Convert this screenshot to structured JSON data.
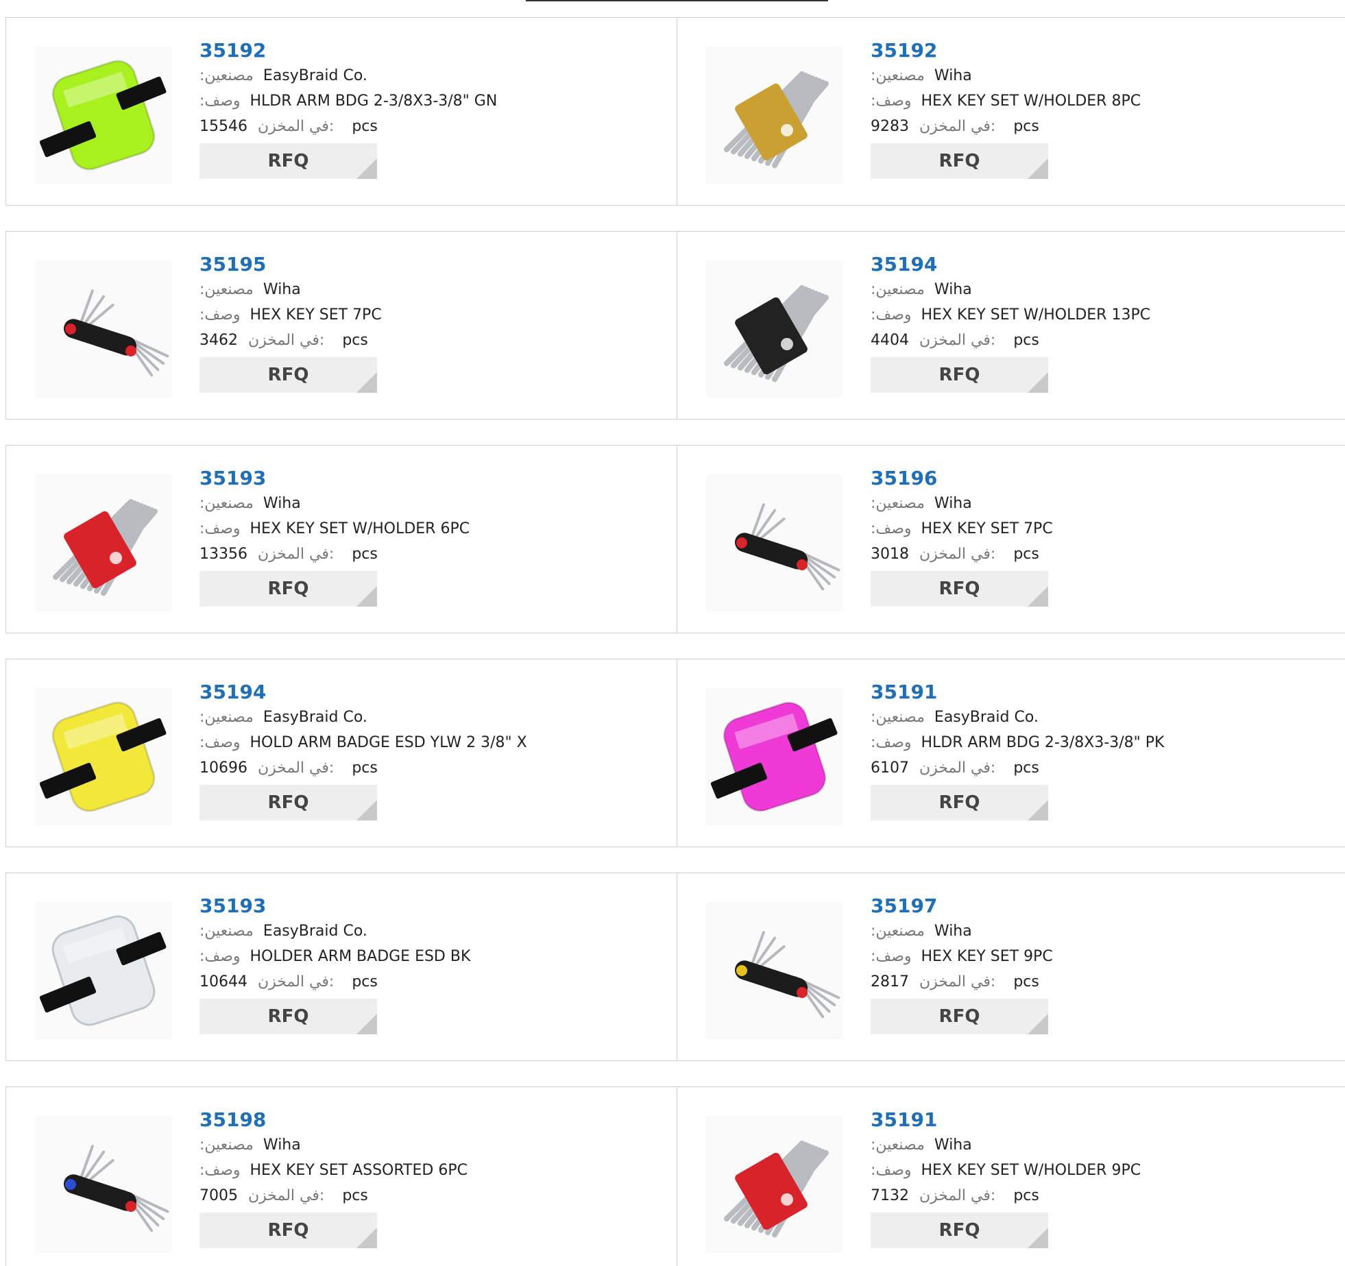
{
  "labels": {
    "manufacturer": ":مصنعين",
    "description": ":وصف",
    "stock": "في المخزن:",
    "unit": "pcs",
    "rfq": "RFQ"
  },
  "products": [
    {
      "part": "35192",
      "mfr": "EasyBraid Co.",
      "desc": "HLDR ARM BDG 2-3/8X3-3/8\" GN",
      "stock": "15546",
      "thumb": "armband-green"
    },
    {
      "part": "35192",
      "mfr": "Wiha",
      "desc": "HEX KEY SET W/HOLDER 8PC",
      "stock": "9283",
      "thumb": "hex-key-holder-yellow"
    },
    {
      "part": "35195",
      "mfr": "Wiha",
      "desc": "HEX KEY SET 7PC",
      "stock": "3462",
      "thumb": "folding-hex-key"
    },
    {
      "part": "35194",
      "mfr": "Wiha",
      "desc": "HEX KEY SET W/HOLDER 13PC",
      "stock": "4404",
      "thumb": "hex-key-holder-black"
    },
    {
      "part": "35193",
      "mfr": "Wiha",
      "desc": "HEX KEY SET W/HOLDER 6PC",
      "stock": "13356",
      "thumb": "hex-key-holder-red"
    },
    {
      "part": "35196",
      "mfr": "Wiha",
      "desc": "HEX KEY SET 7PC",
      "stock": "3018",
      "thumb": "folding-hex-key"
    },
    {
      "part": "35194",
      "mfr": "EasyBraid Co.",
      "desc": "HOLD ARM BADGE ESD YLW 2 3/8\" X",
      "stock": "10696",
      "thumb": "armband-yellow"
    },
    {
      "part": "35191",
      "mfr": "EasyBraid Co.",
      "desc": "HLDR ARM BDG 2-3/8X3-3/8\" PK",
      "stock": "6107",
      "thumb": "armband-pink"
    },
    {
      "part": "35193",
      "mfr": "EasyBraid Co.",
      "desc": "HOLDER ARM BADGE ESD BK",
      "stock": "10644",
      "thumb": "armband-clear"
    },
    {
      "part": "35197",
      "mfr": "Wiha",
      "desc": "HEX KEY SET 9PC",
      "stock": "2817",
      "thumb": "folding-hex-key-yellow"
    },
    {
      "part": "35198",
      "mfr": "Wiha",
      "desc": "HEX KEY SET ASSORTED 6PC",
      "stock": "7005",
      "thumb": "folding-hex-key-blue"
    },
    {
      "part": "35191",
      "mfr": "Wiha",
      "desc": "HEX KEY SET W/HOLDER 9PC",
      "stock": "7132",
      "thumb": "hex-key-holder-red"
    }
  ],
  "colors": {
    "link": "#1e6fb8",
    "armband-green": "#a8f01e",
    "armband-yellow": "#f2e83a",
    "armband-pink": "#f03ad8",
    "armband-clear": "#e8ecef",
    "holder-yellow": "#caa032",
    "holder-red": "#d8232a",
    "holder-black": "#222222"
  }
}
